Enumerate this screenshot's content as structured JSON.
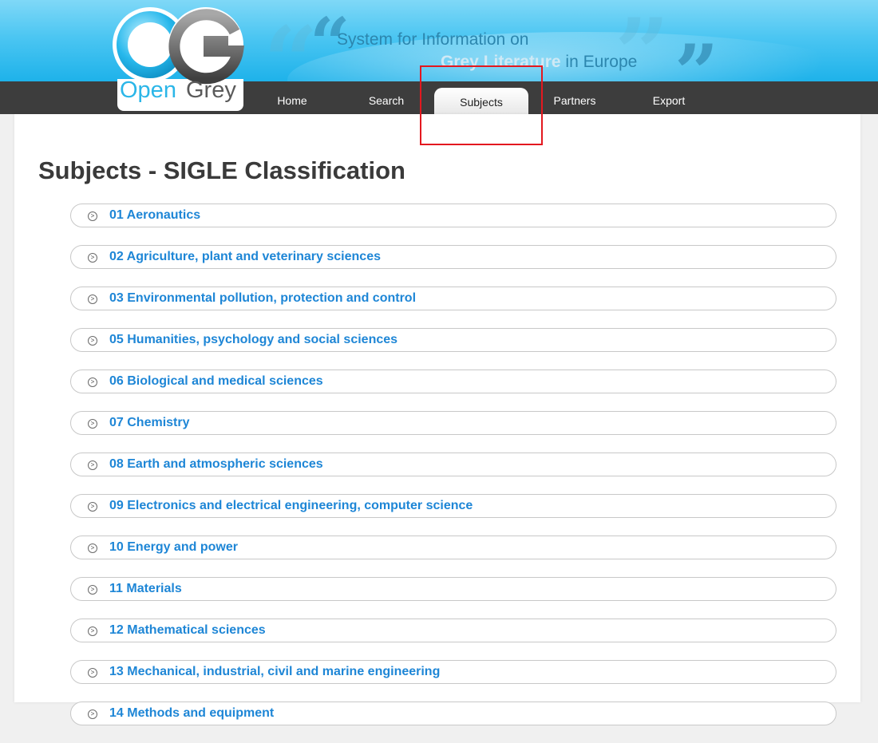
{
  "header": {
    "tagline_line1": "System for Information on",
    "tagline_grey": "Grey Literature",
    "tagline_rest": "in Europe",
    "logo_open": "Open",
    "logo_grey": "Grey"
  },
  "nav": {
    "items": [
      "Home",
      "Search",
      "Subjects",
      "Partners",
      "Export"
    ],
    "active": "Subjects"
  },
  "main": {
    "title": "Subjects - SIGLE Classification",
    "subjects": [
      "01 Aeronautics",
      "02 Agriculture, plant and veterinary sciences",
      "03 Environmental pollution, protection and control",
      "05 Humanities, psychology and social sciences",
      "06 Biological and medical sciences",
      "07 Chemistry",
      "08 Earth and atmospheric sciences",
      "09 Electronics and electrical engineering, computer science",
      "10 Energy and power",
      "11 Materials",
      "12 Mathematical sciences",
      "13 Mechanical, industrial, civil and marine engineering",
      "14 Methods and equipment"
    ]
  },
  "colors": {
    "banner": "#1eb2ea",
    "nav": "#3d3d3d",
    "link": "#1e86d6",
    "highlight": "#e3181f"
  }
}
